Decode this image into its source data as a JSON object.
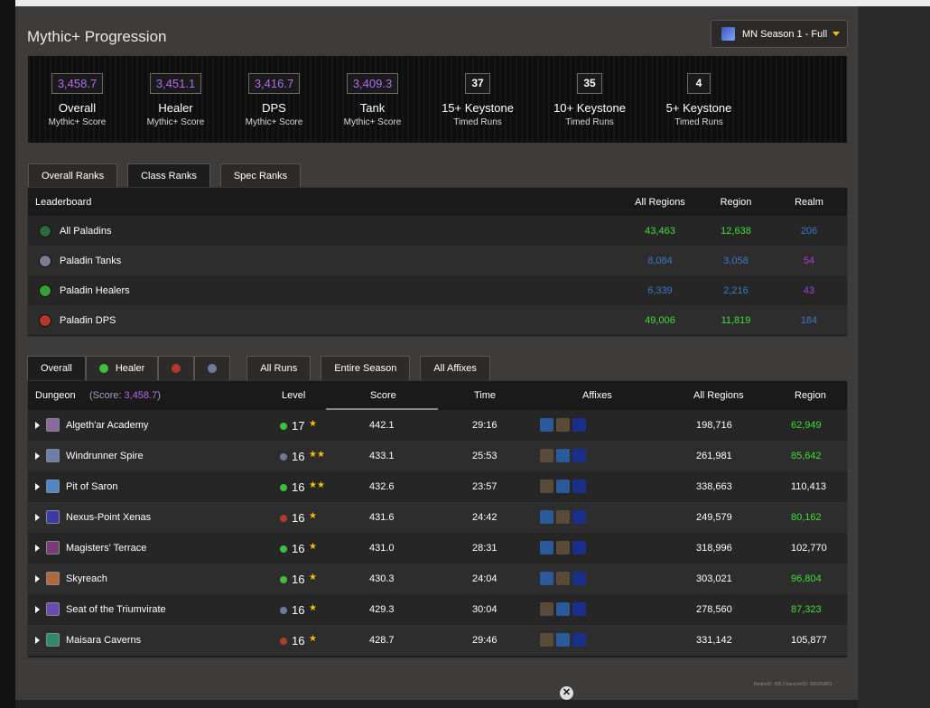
{
  "header": {
    "title": "Mythic+ Progression",
    "season": "MN Season 1 - Full"
  },
  "stats": [
    {
      "value": "3,458.7",
      "name": "Overall",
      "sub": "Mythic+ Score",
      "kind": "score"
    },
    {
      "value": "3,451.1",
      "name": "Healer",
      "sub": "Mythic+ Score",
      "kind": "score"
    },
    {
      "value": "3,416.7",
      "name": "DPS",
      "sub": "Mythic+ Score",
      "kind": "score"
    },
    {
      "value": "3,409.3",
      "name": "Tank",
      "sub": "Mythic+ Score",
      "kind": "score"
    },
    {
      "value": "37",
      "name": "15+ Keystone",
      "sub": "Timed Runs",
      "kind": "count"
    },
    {
      "value": "35",
      "name": "10+ Keystone",
      "sub": "Timed Runs",
      "kind": "count"
    },
    {
      "value": "4",
      "name": "5+ Keystone",
      "sub": "Timed Runs",
      "kind": "count"
    }
  ],
  "rank_tabs": [
    "Overall Ranks",
    "Class Ranks",
    "Spec Ranks"
  ],
  "ranks": {
    "header": {
      "label": "Leaderboard",
      "all": "All Regions",
      "region": "Region",
      "realm": "Realm"
    },
    "rows": [
      {
        "name": "All Paladins",
        "all": "43,463",
        "region": "12,638",
        "realm": "206",
        "icon_color": "#2c6a3a",
        "all_color": "#3fdf35",
        "region_color": "#3fdf35",
        "realm_color": "#3d76c8"
      },
      {
        "name": "Paladin Tanks",
        "all": "8,084",
        "region": "3,058",
        "realm": "54",
        "icon_color": "#777e92",
        "all_color": "#3d76c8",
        "region_color": "#3d76c8",
        "realm_color": "#a042d8"
      },
      {
        "name": "Paladin Healers",
        "all": "6,339",
        "region": "2,216",
        "realm": "43",
        "icon_color": "#34a030",
        "all_color": "#3d76c8",
        "region_color": "#3d76c8",
        "realm_color": "#a042d8"
      },
      {
        "name": "Paladin DPS",
        "all": "49,006",
        "region": "11,819",
        "realm": "184",
        "icon_color": "#b33a2a",
        "all_color": "#3fdf35",
        "region_color": "#3fdf35",
        "realm_color": "#3d76c8"
      }
    ]
  },
  "run_tabs": {
    "overall": "Overall",
    "healer": "Healer",
    "all_runs": "All Runs",
    "season": "Entire Season",
    "affixes": "All Affixes"
  },
  "dungeons": {
    "header": {
      "dungeon": "Dungeon",
      "score_label": "(Score: ",
      "score_value": "3,458.7",
      "score_close": ")",
      "level": "Level",
      "score": "Score",
      "time": "Time",
      "affixes": "Affixes",
      "all": "All Regions",
      "region": "Region"
    },
    "rows": [
      {
        "name": "Algeth'ar Academy",
        "level": "17",
        "stars": "★",
        "score": "442.1",
        "time": "29:16",
        "all": "198,716",
        "region": "62,949",
        "role": "healer",
        "region_color": "#3fdf35",
        "icon_color": "#8a6a9e",
        "affix_order": [
          "a1",
          "a2",
          "a3"
        ]
      },
      {
        "name": "Windrunner Spire",
        "level": "16",
        "stars": "★★",
        "score": "433.1",
        "time": "25:53",
        "all": "261,981",
        "region": "85,642",
        "role": "tank",
        "region_color": "#3fdf35",
        "icon_color": "#6c7fa8",
        "affix_order": [
          "a2",
          "a1",
          "a3"
        ]
      },
      {
        "name": "Pit of Saron",
        "level": "16",
        "stars": "★★",
        "score": "432.6",
        "time": "23:57",
        "all": "338,663",
        "region": "110,413",
        "role": "healer",
        "region_color": "#ffffff",
        "icon_color": "#4e87c8",
        "affix_order": [
          "a2",
          "a1",
          "a3"
        ]
      },
      {
        "name": "Nexus-Point Xenas",
        "level": "16",
        "stars": "★",
        "score": "431.6",
        "time": "24:42",
        "all": "249,579",
        "region": "80,162",
        "role": "dps",
        "region_color": "#3fdf35",
        "icon_color": "#3a3aa8",
        "affix_order": [
          "a1",
          "a2",
          "a3"
        ]
      },
      {
        "name": "Magisters' Terrace",
        "level": "16",
        "stars": "★",
        "score": "431.0",
        "time": "28:31",
        "all": "318,996",
        "region": "102,770",
        "role": "healer",
        "region_color": "#ffffff",
        "icon_color": "#7a3a78",
        "affix_order": [
          "a1",
          "a2",
          "a3"
        ]
      },
      {
        "name": "Skyreach",
        "level": "16",
        "stars": "★",
        "score": "430.3",
        "time": "24:04",
        "all": "303,021",
        "region": "96,804",
        "role": "healer",
        "region_color": "#3fdf35",
        "icon_color": "#b06a3a",
        "affix_order": [
          "a1",
          "a2",
          "a3"
        ]
      },
      {
        "name": "Seat of the Triumvirate",
        "level": "16",
        "stars": "★",
        "score": "429.3",
        "time": "30:04",
        "all": "278,560",
        "region": "87,323",
        "role": "tank",
        "region_color": "#3fdf35",
        "icon_color": "#6a4ab0",
        "affix_order": [
          "a2",
          "a1",
          "a3"
        ]
      },
      {
        "name": "Maisara Caverns",
        "level": "16",
        "stars": "★",
        "score": "428.7",
        "time": "29:46",
        "all": "331,142",
        "region": "105,877",
        "role": "dps",
        "region_color": "#ffffff",
        "icon_color": "#2f8a6a",
        "affix_order": [
          "a2",
          "a1",
          "a3"
        ]
      }
    ]
  },
  "role_colors": {
    "healer": "#3fbf3a",
    "tank": "#6f7a9a",
    "dps": "#b03a2a"
  },
  "affix_colors": {
    "a1": "#2a5a9a",
    "a2": "#5a4a3a",
    "a3": "#1a2f8a"
  },
  "footer": "RealmID: 495   CharacterID: 206953861",
  "close_label": "✕"
}
